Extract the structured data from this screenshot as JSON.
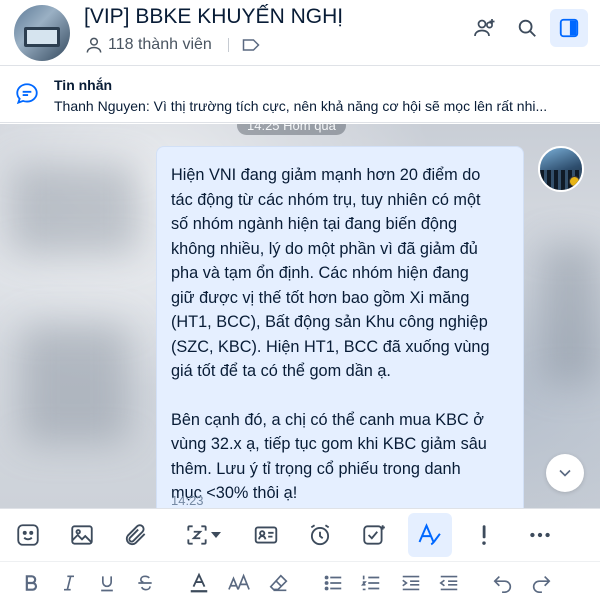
{
  "header": {
    "group_title": "[VIP] BBKE KHUYẾN NGHỊ",
    "member_count": "118 thành viên"
  },
  "pinned": {
    "title": "Tin nhắn",
    "preview": "Thanh Nguyen: Vì thị trường tích cực, nên khả năng cơ hội sẽ mọc lên rất nhi..."
  },
  "chat": {
    "date_separator": "14:25 Hôm qua",
    "message": {
      "paragraph1": "Hiện VNI đang giảm mạnh hơn 20 điểm do\ntác động từ các nhóm trụ, tuy nhiên có một\nsố nhóm ngành hiện tại đang biến động\nkhông nhiều, lý do một phần vì đã giảm đủ\npha và tạm ổn định. Các nhóm hiện đang\ngiữ được vị thế tốt hơn bao gồm Xi măng\n(HT1, BCC), Bất động sản Khu công nghiệp\n(SZC, KBC). Hiện HT1, BCC đã xuống vùng\ngiá tốt để ta có thể gom dần ạ.",
      "paragraph2": "Bên cạnh đó, a chị có thể canh mua KBC ở\nvùng 32.x ạ, tiếp tục gom khi KBC giảm sâu\nthêm. Lưu ý tỉ trọng cổ phiếu trong danh\nmục <30% thôi ạ!",
      "time": "14:23"
    }
  },
  "icons": {
    "add_member": "add-member-icon",
    "search": "search-icon",
    "panel": "panel-toggle-icon",
    "tag": "tag-icon",
    "members": "members-icon",
    "pinned_message": "message-bubble-icon",
    "scroll_down": "chevron-down-icon"
  },
  "toolbar": [
    "sticker-icon",
    "image-icon",
    "attachment-icon",
    "screenshot-icon",
    "contact-card-icon",
    "reminder-clock-icon",
    "task-icon",
    "format-text-icon",
    "urgent-icon",
    "more-icon"
  ],
  "formatbar": [
    "bold-icon",
    "italic-icon",
    "underline-icon",
    "strikethrough-icon",
    "font-color-icon",
    "font-size-icon",
    "clear-format-icon",
    "bullet-list-icon",
    "numbered-list-icon",
    "indent-icon",
    "outdent-icon",
    "undo-icon",
    "redo-icon"
  ],
  "colors": {
    "accent": "#0068ff",
    "bubble_bg": "#e5efff",
    "text": "#081c36"
  }
}
